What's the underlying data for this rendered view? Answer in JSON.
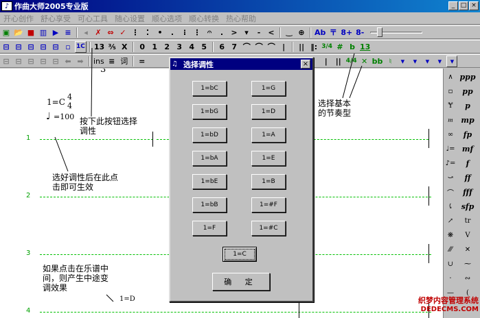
{
  "window": {
    "title": "作曲大师2005专业版"
  },
  "menu": [
    "开心创作",
    "舒心享受",
    "可心工具",
    "随心设置",
    "顺心选项",
    "顺心转换",
    "热心帮助"
  ],
  "toolbar1": [
    "■",
    "▥",
    "▶",
    "≡",
    "|",
    "◂",
    "✗",
    "⇔",
    "✓",
    "⋮",
    "⁚",
    "•",
    ".",
    "⁝",
    "⋮",
    "𝄐",
    ".",
    ">",
    "▾",
    "-",
    "<",
    "‿",
    "⊕",
    "Ab",
    "〒",
    "8+",
    "8-"
  ],
  "toolbar2": [
    "1C",
    "13",
    "⅗",
    "X",
    "0",
    "1",
    "2",
    "3",
    "4",
    "5",
    "6",
    "7",
    "⌒",
    "⌒",
    "⌒",
    "|",
    "||",
    "3/4",
    "#",
    "b",
    "13"
  ],
  "toolbar3": [
    "ins",
    "≡",
    "词",
    "=",
    "|",
    "||",
    "4/4",
    "✕",
    "bb",
    "♮",
    "▾",
    "▾",
    "▾",
    "▾",
    "▾"
  ],
  "score": {
    "key_label": "1=C",
    "time_top": "4",
    "time_bottom": "4",
    "tempo": "=100",
    "line_numbers": [
      "1",
      "2",
      "3",
      "4"
    ],
    "inline_key": "1=D",
    "stray_mark": "3"
  },
  "annotations": {
    "press_button": "按下此按钮选择\n调性",
    "choose_meter": "选择基本\n的节奏型",
    "click_apply": "选好调性后在此点\n击即可生效",
    "mid_change": "如果点击在乐谱中\n间，则产生中途变\n调效果"
  },
  "dialog": {
    "title": "选择调性",
    "close": "×",
    "keys_left": [
      "1=bC",
      "1=bG",
      "1=bD",
      "1=bA",
      "1=bE",
      "1=bB",
      "1=F"
    ],
    "keys_right": [
      "1=G",
      "1=D",
      "1=A",
      "1=E",
      "1=B",
      "1=#F",
      "1=#C"
    ],
    "selected_key": "1=C",
    "ok": "确 定"
  },
  "palette": [
    [
      "∧",
      "ppp"
    ],
    [
      "▫",
      "pp"
    ],
    [
      "Ɏ",
      "p"
    ],
    [
      "𝆐",
      "mp"
    ],
    [
      "∞",
      "fp"
    ],
    [
      "♩=",
      "mf"
    ],
    [
      "♪=",
      "f"
    ],
    [
      "⤻",
      "ff"
    ],
    [
      "⌒",
      "fff"
    ],
    [
      "⤹",
      "sfp"
    ],
    [
      "↗",
      "tr"
    ],
    [
      "❋",
      "V"
    ],
    [
      "⁄⁄⁄",
      "✕"
    ],
    [
      "∪",
      "⁓"
    ],
    [
      "·",
      "∾"
    ],
    [
      "—",
      "("
    ]
  ],
  "watermark": {
    "line1": "织梦内容管理系统",
    "line2": "DEDECMS.COM"
  }
}
